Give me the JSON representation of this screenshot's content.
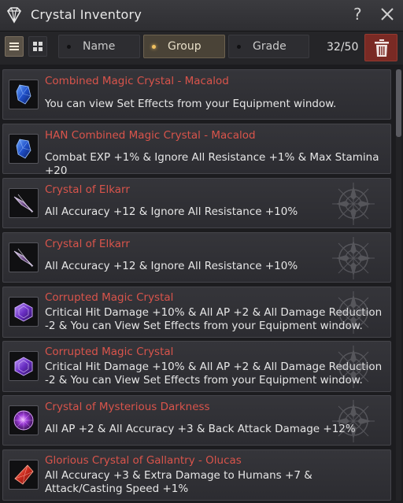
{
  "window": {
    "title": "Crystal Inventory",
    "help_label": "?"
  },
  "toolbar": {
    "sort_options": [
      {
        "label": "Name",
        "active": false
      },
      {
        "label": "Group",
        "active": true
      },
      {
        "label": "Grade",
        "active": false
      }
    ],
    "count": "32/50"
  },
  "colors": {
    "accent": "#f0c060",
    "item_name": "#d9544b",
    "delete_button": "#7a2a24"
  },
  "items": [
    {
      "name": "Combined Magic Crystal - Macalod",
      "description": "You can view Set Effects from your Equipment window.",
      "icon": "blue-crystal-icon"
    },
    {
      "name": "HAN Combined Magic Crystal - Macalod",
      "description": "Combat EXP +1% & Ignore All Resistance +1% & Max Stamina +20",
      "icon": "blue-crystal-icon"
    },
    {
      "name": "Crystal of Elkarr",
      "description": "All Accuracy +12 & Ignore All Resistance +10%",
      "icon": "elkarr-crystal-icon"
    },
    {
      "name": "Crystal of Elkarr",
      "description": "All Accuracy +12 & Ignore All Resistance +10%",
      "icon": "elkarr-crystal-icon"
    },
    {
      "name": "Corrupted Magic Crystal",
      "description": "Critical Hit Damage +10% & All AP +2 & All Damage Reduction -2 & You can View Set Effects from your Equipment window.",
      "icon": "corrupted-crystal-icon"
    },
    {
      "name": "Corrupted Magic Crystal",
      "description": "Critical Hit Damage +10% & All AP +2 & All Damage Reduction -2 & You can View Set Effects from your Equipment window.",
      "icon": "corrupted-crystal-icon"
    },
    {
      "name": "Crystal of Mysterious Darkness",
      "description": "All AP +2 & All Accuracy +3 & Back Attack Damage +12%",
      "icon": "darkness-crystal-icon"
    },
    {
      "name": "Glorious Crystal of Gallantry - Olucas",
      "description": "All Accuracy +3 & Extra Damage to Humans +7 & Attack/Casting Speed +1%",
      "icon": "red-crystal-icon"
    }
  ]
}
